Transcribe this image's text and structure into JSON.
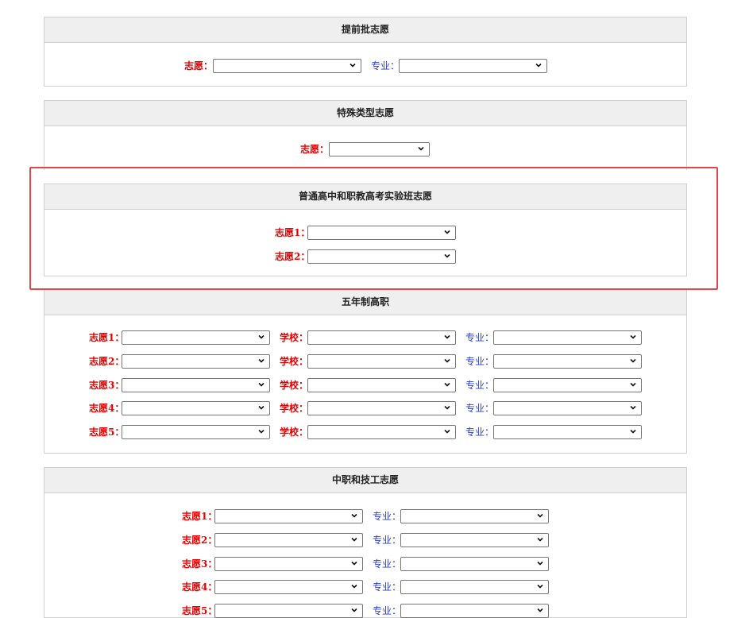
{
  "sections": {
    "early": {
      "title": "提前批志愿",
      "choice_label": "志愿：",
      "major_label": "专业："
    },
    "special": {
      "title": "特殊类型志愿",
      "choice_label": "志愿："
    },
    "experimental": {
      "title": "普通高中和职教高考实验班志愿",
      "choice1_label": "志愿1：",
      "choice2_label": "志愿2："
    },
    "five_year": {
      "title": "五年制高职",
      "rows": [
        {
          "choice_label": "志愿1：",
          "school_label": "学校：",
          "major_label": "专业："
        },
        {
          "choice_label": "志愿2：",
          "school_label": "学校：",
          "major_label": "专业："
        },
        {
          "choice_label": "志愿3：",
          "school_label": "学校：",
          "major_label": "专业："
        },
        {
          "choice_label": "志愿4：",
          "school_label": "学校：",
          "major_label": "专业："
        },
        {
          "choice_label": "志愿5：",
          "school_label": "学校：",
          "major_label": "专业："
        }
      ]
    },
    "vocational": {
      "title": "中职和技工志愿",
      "rows": [
        {
          "choice_label": "志愿1：",
          "major_label": "专业："
        },
        {
          "choice_label": "志愿2：",
          "major_label": "专业："
        },
        {
          "choice_label": "志愿3：",
          "major_label": "专业："
        },
        {
          "choice_label": "志愿4：",
          "major_label": "专业："
        },
        {
          "choice_label": "志愿5：",
          "major_label": "专业："
        }
      ]
    }
  },
  "colors": {
    "required_label": "#e60000",
    "secondary_label": "#2a3fd6",
    "highlight_frame": "#e0474c",
    "header_bg": "#efefef"
  },
  "icons": {
    "dropdown": "chevron-down-icon"
  }
}
